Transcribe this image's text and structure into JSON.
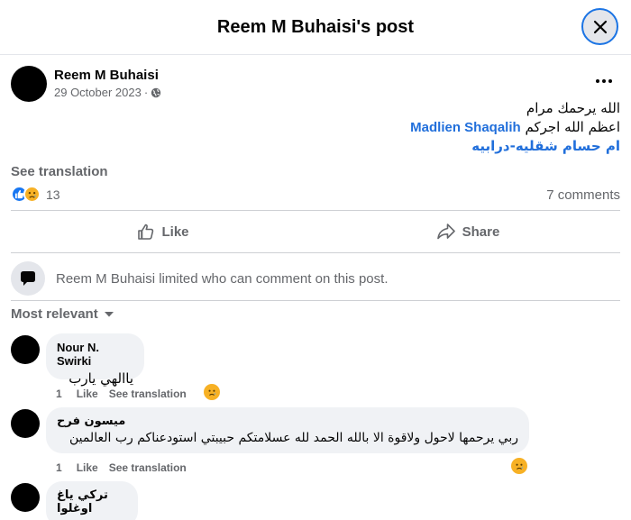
{
  "header": {
    "title": "Reem M Buhaisi's post"
  },
  "post": {
    "author": "Reem M Buhaisi",
    "date": "29 October 2023",
    "date_separator": "·",
    "lines": {
      "line1": "الله يرحمك مرام",
      "line2_text": "اعظم الله اجركم",
      "line2_mention": "Madlien Shaqalih",
      "line3_mention": "ام حسام شقليه-درابيه"
    },
    "see_translation": "See translation",
    "reaction_count": "13",
    "comments_count": "7 comments",
    "like_label": "Like",
    "share_label": "Share"
  },
  "limited_notice": "Reem M Buhaisi limited who can comment on this post.",
  "sort_label": "Most relevant",
  "comments": [
    {
      "author": "Nour N. Swirki",
      "text": "ياالهي يارب",
      "time": "1",
      "like": "Like",
      "translate": "See translation"
    },
    {
      "author": "ميسون فرح",
      "text": "ربي يرحمها لاحول ولاقوة الا بالله الحمد لله عسلامتكم حبيبتي استودعناكم رب العالمين",
      "time": "1",
      "like": "Like",
      "translate": "See translation"
    },
    {
      "author": "تركي ياغ اوغلوا"
    }
  ],
  "colors": {
    "accent": "#1877f2",
    "mention": "#216fdb",
    "muted": "#65676b",
    "bubble": "#f0f2f5"
  }
}
